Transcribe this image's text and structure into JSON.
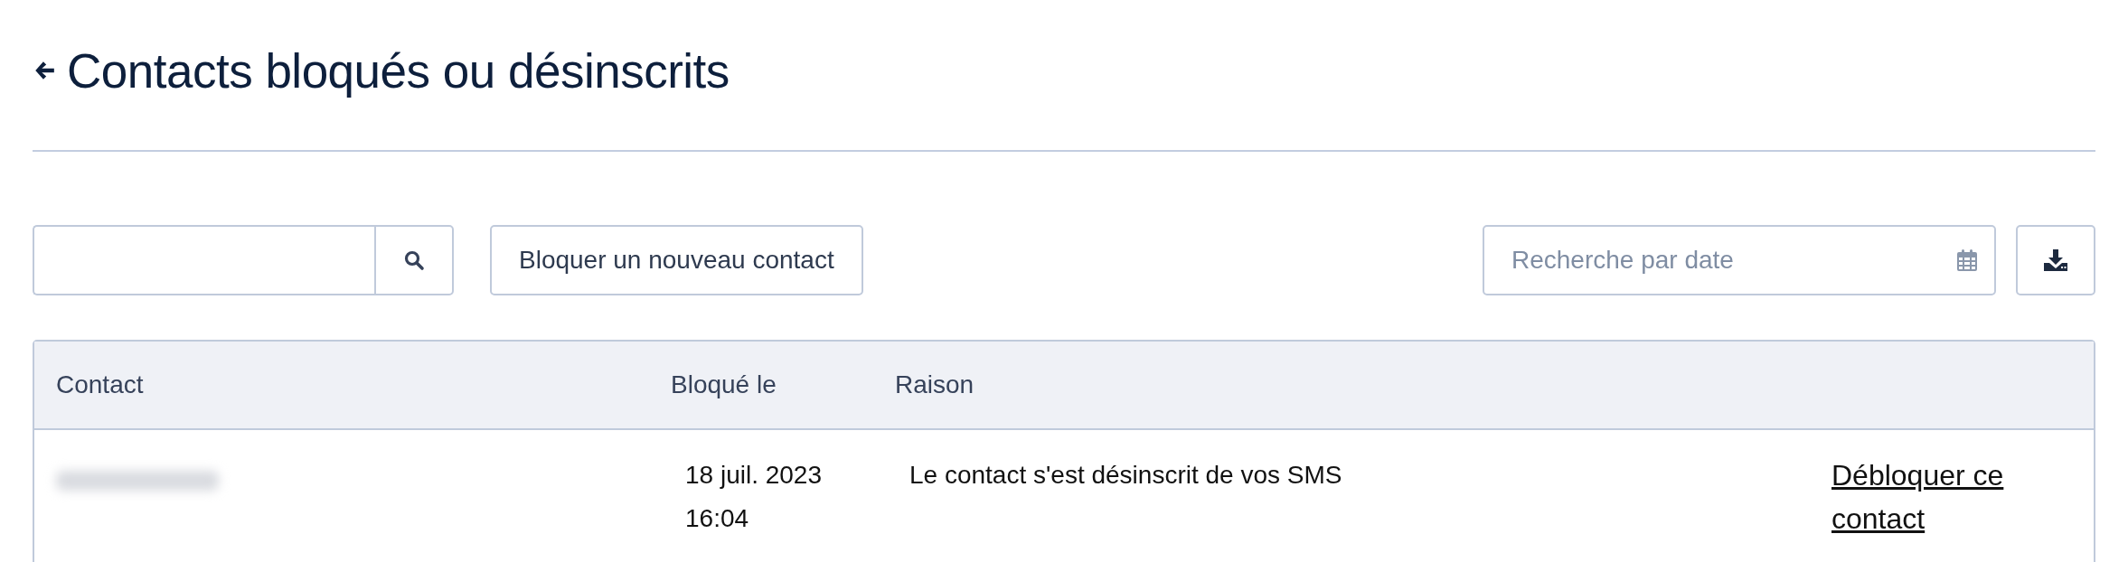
{
  "title": "Contacts bloqués ou désinscrits",
  "toolbar": {
    "block_button": "Bloquer un nouveau contact",
    "date_field": {
      "placeholder": "Recherche par date"
    }
  },
  "table": {
    "columns": [
      "Contact",
      "Bloqué le",
      "Raison"
    ],
    "rows": [
      {
        "contact_redacted": true,
        "date": "18 juil. 2023",
        "time": "16:04",
        "reason": "Le contact s'est désinscrit de vos SMS",
        "action": "Débloquer ce contact"
      }
    ]
  }
}
